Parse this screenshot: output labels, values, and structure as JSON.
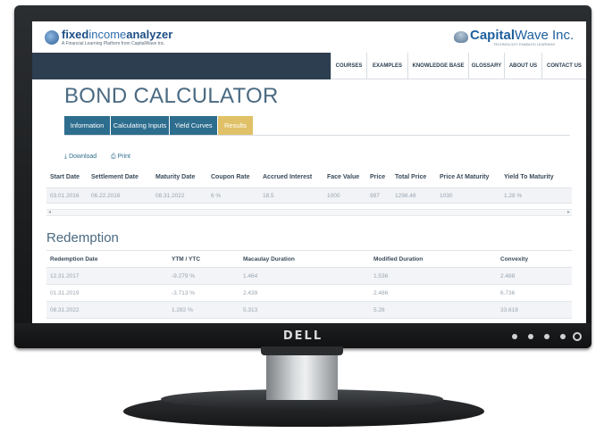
{
  "monitor": {
    "brand": "D∉LL"
  },
  "header": {
    "logo_left_strong": "fixed",
    "logo_left_light": "income",
    "logo_left_strong2": "analyzer",
    "logo_left_tagline": "A Financial Learning Platform from CapitalWave Inc.",
    "logo_right_strong": "Capital",
    "logo_right_light": "Wave Inc.",
    "logo_right_tagline": "TECHNOLOGY ENABLED LEARNING"
  },
  "nav": {
    "items": [
      "COURSES",
      "EXAMPLES",
      "KNOWLEDGE BASE",
      "GLOSSARY",
      "ABOUT US",
      "CONTACT US"
    ]
  },
  "page": {
    "title": "BOND CALCULATOR",
    "tabs": [
      "Information",
      "Calculating Inputs",
      "Yield Curves",
      "Results"
    ],
    "active_tab": "Results",
    "download_label": "Download",
    "print_label": "Print"
  },
  "summary_table": {
    "headers": [
      "Start Date",
      "Settlement Date",
      "Maturity Date",
      "Coupon Rate",
      "Accrued Interest",
      "Face Value",
      "Price",
      "Total Price",
      "Price At Maturity",
      "Yield To Maturity"
    ],
    "row": [
      "03.01.2016",
      "06.22.2016",
      "08.31.2022",
      "6 %",
      "18.5",
      "1000",
      "997",
      "1298.48",
      "1030",
      "1.28 %"
    ]
  },
  "redemption": {
    "title": "Redemption",
    "headers": [
      "Redemption Date",
      "YTM / YTC",
      "Macaulay Duration",
      "Modified Duration",
      "Convexity"
    ],
    "rows": [
      [
        "12.31.2017",
        "-9.279 %",
        "1.464",
        "1.536",
        "2.488"
      ],
      [
        "01.31.2019",
        "-3.713 %",
        "2.439",
        "2.486",
        "6.736"
      ],
      [
        "08.31.2022",
        "1.282 %",
        "5.313",
        "5.28",
        "33.618"
      ]
    ]
  },
  "colors": {
    "nav_dark": "#2c3e50",
    "tab_blue": "#2d6d8e",
    "tab_active": "#e0c167",
    "title": "#4a6a82"
  }
}
